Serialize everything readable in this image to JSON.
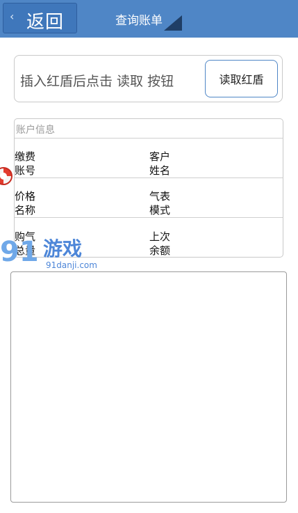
{
  "header": {
    "back_chevron": "‹",
    "back_label": "返回",
    "title": "查询账单"
  },
  "read_panel": {
    "hint": "插入红盾后点击 读取 按钮",
    "read_button": "读取红盾"
  },
  "account_info": {
    "section_title": "账户信息",
    "fields": [
      {
        "label": "缴费账号"
      },
      {
        "label": "客户姓名"
      },
      {
        "label": "价格名称"
      },
      {
        "label": "气表模式"
      },
      {
        "label": "购气总量"
      },
      {
        "label": "上次余额"
      }
    ]
  },
  "watermark": {
    "brand_number": "91",
    "brand_text": "游戏",
    "url": "91danji.com"
  },
  "icons": {
    "back": "chevron-left-icon",
    "title_corner": "corner-triangle-icon",
    "overlay": "lifebuoy-icon"
  },
  "colors": {
    "header_bg": "#4f86c6",
    "back_button_bg": "#3f77bb",
    "read_button_border": "#4f86c6"
  }
}
